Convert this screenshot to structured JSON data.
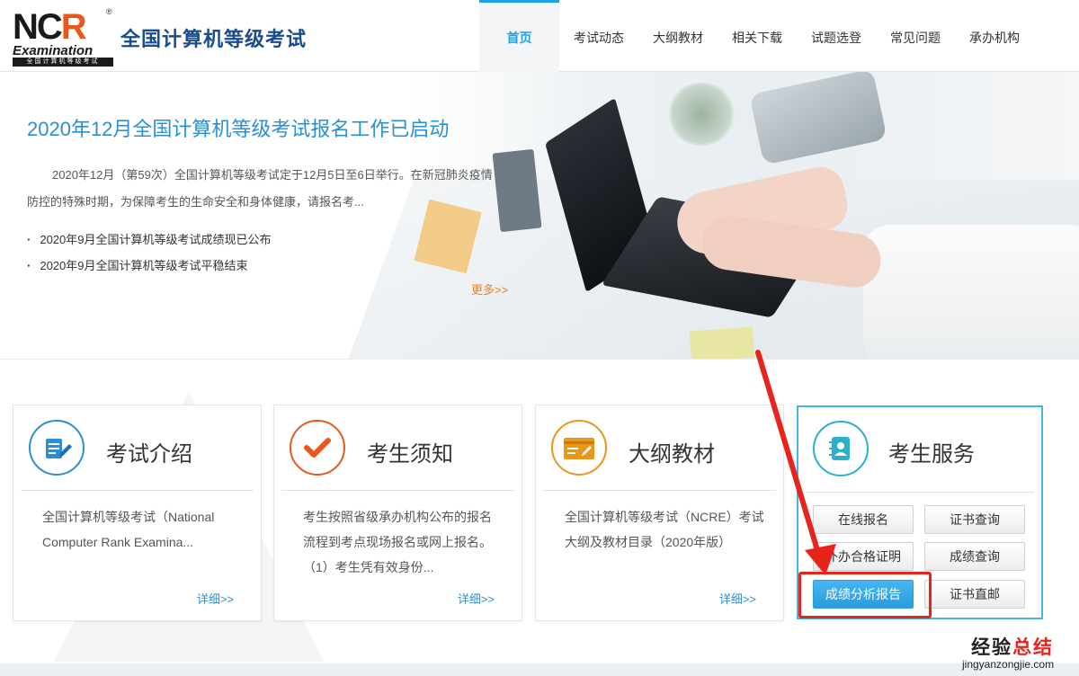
{
  "logo": {
    "mark_main": "NC",
    "mark_accent": "R",
    "reg": "®",
    "subtitle": "Examination",
    "bar_text": "全国计算机等级考试"
  },
  "site_title": "全国计算机等级考试",
  "nav": {
    "items": [
      "首页",
      "考试动态",
      "大纲教材",
      "相关下载",
      "试题选登",
      "常见问题",
      "承办机构"
    ],
    "active_index": 0
  },
  "banner": {
    "title": "2020年12月全国计算机等级考试报名工作已启动",
    "description": "2020年12月（第59次）全国计算机等级考试定于12月5日至6日举行。在新冠肺炎疫情防控的特殊时期，为保障考生的生命安全和身体健康，请报名考...",
    "news": [
      "2020年9月全国计算机等级考试成绩现已公布",
      "2020年9月全国计算机等级考试平稳结束"
    ],
    "more": "更多>>"
  },
  "cards": [
    {
      "title": "考试介绍",
      "desc": "全国计算机等级考试（National Computer Rank Examina...",
      "detail": "详细>>",
      "icon": "document-edit-icon",
      "color": "#2b8fd3"
    },
    {
      "title": "考生须知",
      "desc": "考生按照省级承办机构公布的报名流程到考点现场报名或网上报名。（1）考生凭有效身份...",
      "detail": "详细>>",
      "icon": "checkmark-icon",
      "color": "#e8581c"
    },
    {
      "title": "大纲教材",
      "desc": "全国计算机等级考试（NCRE）考试大纲及教材目录（2020年版）",
      "detail": "详细>>",
      "icon": "id-card-icon",
      "color": "#e8961c"
    }
  ],
  "service": {
    "title": "考生服务",
    "icon": "contact-book-icon",
    "buttons": [
      "在线报名",
      "证书查询",
      "补办合格证明",
      "成绩查询",
      "成绩分析报告",
      "证书直邮"
    ],
    "highlighted": "成绩分析报告"
  },
  "watermark": {
    "cn_main": "经验",
    "cn_accent": "总结",
    "url": "jingyanzongjie.com"
  },
  "colors": {
    "accent": "#1e9fe8",
    "title_blue": "#1a4c8a",
    "highlight_red": "#e8231c",
    "orange": "#e8821c"
  }
}
